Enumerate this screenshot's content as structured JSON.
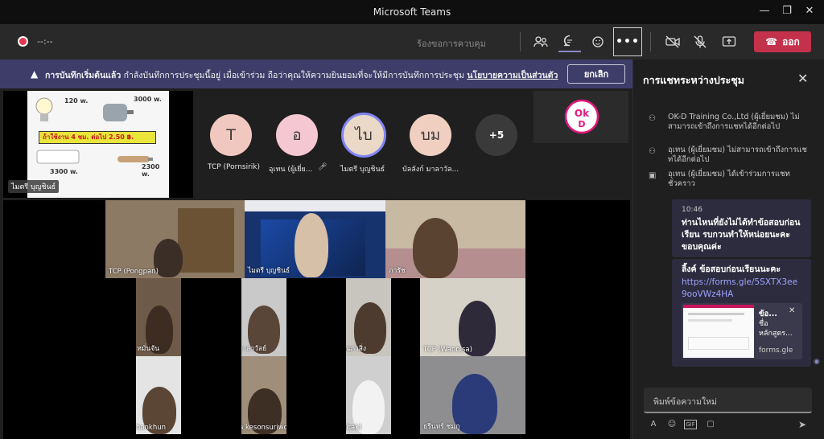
{
  "window": {
    "title": "Microsoft Teams"
  },
  "toolbar": {
    "timer": "--:--",
    "request_control": "ร้องขอการควบคุม",
    "more_label": "•••",
    "leave_label": "ออก"
  },
  "banner": {
    "bold_text": "การบันทึกเริ่มต้นแล้ว",
    "text": "กำลังบันทึกการประชุมนี้อยู่ เมื่อเข้าร่วม ถือว่าคุณให้ความยินยอมที่จะให้มีการบันทึกการประชุม",
    "link": "นโยบายความเป็นส่วนตัว",
    "cancel_label": "ยกเลิก"
  },
  "shared_screen": {
    "presenter": "ไมตรี บุญชินธ์",
    "slide": {
      "w1": "120 w.",
      "w2": "3000 w.",
      "band": "ถ้าใช้งาน 4 ชม. ต่อไป 2.50 ฿.",
      "w3": "3300 w.",
      "w4": "2300 w."
    }
  },
  "participants_strip": [
    {
      "initials": "T",
      "name": "TCP (Pornsirik)",
      "color": "#f1c8bf"
    },
    {
      "initials": "อ",
      "name": "อุเทน (ผู้เยี่ย...",
      "color": "#f4c7d2"
    },
    {
      "initials": "ไบ",
      "name": "ไมตรี บุญชินธ์",
      "color": "#ead9c6"
    },
    {
      "initials": "บม",
      "name": "บัลลังก์ มาลาวัล...",
      "color": "#f0cfc0"
    },
    {
      "initials": "+5",
      "name": "",
      "color": "#3a3a3a"
    }
  ],
  "logo": {
    "text": "OK-D"
  },
  "video_tiles": [
    {
      "name": "TCP (Pongpan)"
    },
    {
      "name": "ไมตรี บุญชินธ์"
    },
    {
      "name": "ภารัช"
    },
    {
      "name": "ศรายุทธ หมั่นจัน"
    },
    {
      "name": "บัลลังก์ มาลาวัลย์"
    },
    {
      "name": "จีระพันธ์ พรวรรณภาสิ่ง"
    },
    {
      "name": "TCP (Wannisa)"
    },
    {
      "name": "prichaphonkhun"
    },
    {
      "name": "kritsada kesonsuriwong"
    },
    {
      "name": "TCP (Phitak)"
    },
    {
      "name": "ธรีนทร์ ชมภู"
    }
  ],
  "chat": {
    "title": "การแชทระหว่างประชุม",
    "system_messages": [
      "OK-D Training Co.,Ltd (ผู้เยี่ยมชม) ไม่สามารถเข้าถึงการแชทได้อีกต่อไป",
      "อุเทน (ผู้เยี่ยมชม) ไม่สามารถเข้าถึงการแชทได้อีกต่อไป",
      "อุเทน (ผู้เยี่ยมชม) ได้เข้าร่วมการแชทชั่วคราว"
    ],
    "message_time": "10:46",
    "message_text": "ท่านไหนที่ยังไม่ได้ทำข้อสอบก่อนเรียน รบกวนทำให้หน่อยนะคะ ขอบคุณค่ะ",
    "message2_text": "ลิ้งค์ ข้อสอบก่อนเรียนนะคะ",
    "message2_link": "https://forms.gle/5SXTX3ee9ooVWz4HA",
    "card_title": "ข้อ...",
    "card_sub": "ชื่อ หลักสูตร...",
    "card_domain": "forms.gle",
    "input_placeholder": "พิมพ์ข้อความใหม่"
  }
}
